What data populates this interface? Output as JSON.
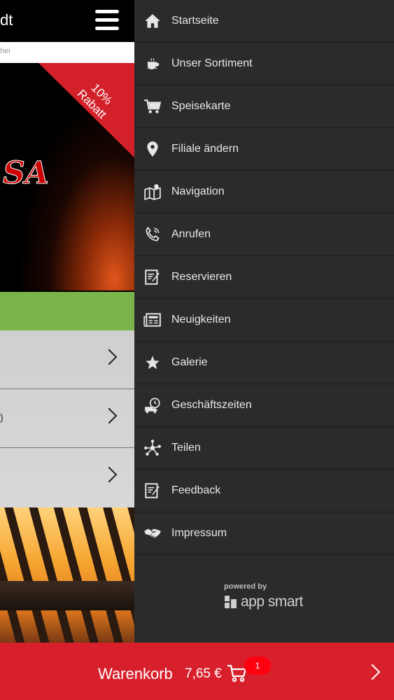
{
  "left_page": {
    "title": "dt",
    "search_placeholder": "hei",
    "promo_ribbon": "10%\nRabatt",
    "logo": "SA",
    "row_texts": [
      "",
      ")",
      ""
    ]
  },
  "menu": {
    "items": [
      {
        "label": "Startseite",
        "icon": "home-icon"
      },
      {
        "label": "Unser Sortiment",
        "icon": "cup-icon"
      },
      {
        "label": "Speisekarte",
        "icon": "cart-icon"
      },
      {
        "label": "Filiale ändern",
        "icon": "location-pin-icon"
      },
      {
        "label": "Navigation",
        "icon": "map-icon"
      },
      {
        "label": "Anrufen",
        "icon": "phone-icon"
      },
      {
        "label": "Reservieren",
        "icon": "edit-note-icon"
      },
      {
        "label": "Neuigkeiten",
        "icon": "newspaper-icon"
      },
      {
        "label": "Galerie",
        "icon": "star-icon"
      },
      {
        "label": "Geschäftszeiten",
        "icon": "delivery-clock-icon"
      },
      {
        "label": "Teilen",
        "icon": "share-icon"
      },
      {
        "label": "Feedback",
        "icon": "feedback-icon"
      },
      {
        "label": "Impressum",
        "icon": "handshake-icon"
      }
    ],
    "powered_by": "powered by",
    "brand": "app smart"
  },
  "cart": {
    "label": "Warenkorb",
    "price": "7,65 €",
    "count": "1"
  },
  "colors": {
    "drawer_bg": "#2b2b2b",
    "cart_bar": "#d8202c",
    "badge": "#ff0010",
    "accent_green": "#79b54a"
  }
}
